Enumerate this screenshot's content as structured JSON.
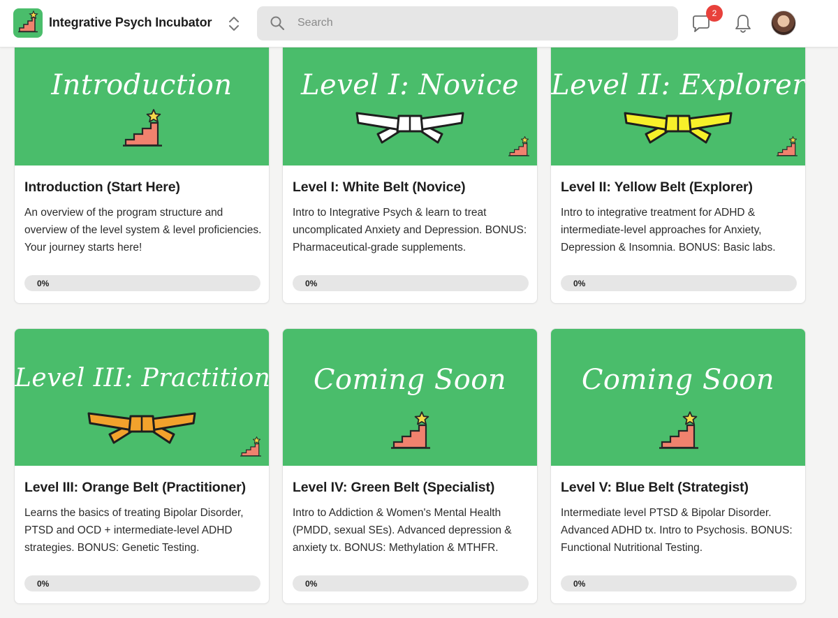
{
  "header": {
    "app_title": "Integrative Psych Incubator",
    "search_placeholder": "Search",
    "chat_badge_count": "2",
    "icons": [
      "app-logo-icon",
      "switcher-chevrons-icon",
      "search-icon",
      "chat-icon",
      "bell-icon",
      "avatar"
    ]
  },
  "colors": {
    "banner_green": "#4abd6b",
    "badge_red": "#e8413b",
    "stairs_salmon": "#f0826e",
    "star_yellow": "#f5d94a",
    "belt_white": "#ffffff",
    "belt_yellow": "#f7f02a",
    "belt_orange": "#f2a22c"
  },
  "courses": [
    {
      "banner_text": "Introduction",
      "banner_art": "stairs-star-icon",
      "title": "Introduction (Start Here)",
      "description": "An overview of the program structure and overview of the level system & level proficiencies. Your journey starts here!",
      "progress_label": "0%",
      "progress": 0
    },
    {
      "banner_text": "Level I: Novice",
      "banner_art": "white-belt-icon",
      "title": "Level I: White Belt (Novice)",
      "description": "Intro to Integrative Psych & learn to treat uncomplicated Anxiety and Depression. BONUS: Pharmaceutical-grade supplements.",
      "progress_label": "0%",
      "progress": 0
    },
    {
      "banner_text": "Level II: Explorer",
      "banner_art": "yellow-belt-icon",
      "title": "Level II: Yellow Belt (Explorer)",
      "description": "Intro to integrative treatment for ADHD & intermediate-level approaches for Anxiety, Depression & Insomnia. BONUS: Basic labs.",
      "progress_label": "0%",
      "progress": 0
    },
    {
      "banner_text": "Level III: Practitioner",
      "banner_art": "orange-belt-icon",
      "title": "Level III: Orange Belt (Practitioner)",
      "description": "Learns the basics of treating Bipolar Disorder, PTSD and OCD + intermediate-level ADHD strategies. BONUS: Genetic Testing.",
      "progress_label": "0%",
      "progress": 0
    },
    {
      "banner_text": "Coming Soon",
      "banner_art": "stairs-star-icon",
      "title": "Level IV: Green Belt (Specialist)",
      "description": "Intro to Addiction & Women's Mental Health (PMDD, sexual SEs). Advanced depression & anxiety tx. BONUS: Methylation & MTHFR.",
      "progress_label": "0%",
      "progress": 0
    },
    {
      "banner_text": "Coming Soon",
      "banner_art": "stairs-star-icon",
      "title": "Level V: Blue Belt (Strategist)",
      "description": "Intermediate level PTSD & Bipolar Disorder. Advanced ADHD tx. Intro to Psychosis. BONUS: Functional Nutritional Testing.",
      "progress_label": "0%",
      "progress": 0
    }
  ]
}
